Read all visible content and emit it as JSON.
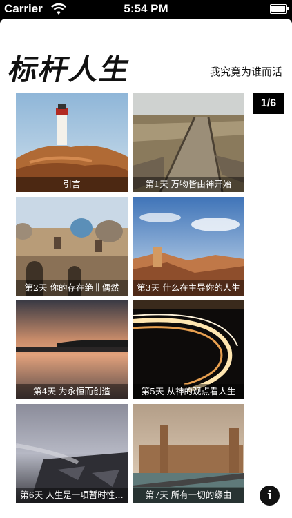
{
  "status_bar": {
    "carrier": "Carrier",
    "time": "5:54 PM"
  },
  "header": {
    "title": "标杆人生",
    "subtitle": "我究竟为谁而活"
  },
  "page_indicator": "1/6",
  "tiles": [
    {
      "caption": "引言",
      "icon": "lighthouse-photo"
    },
    {
      "caption": "第1天 万物皆由神开始",
      "icon": "boardwalk-photo"
    },
    {
      "caption": "第2天 你的存在绝非偶然",
      "icon": "church-photo"
    },
    {
      "caption": "第3天 什么在主导你的人生",
      "icon": "canyon-photo"
    },
    {
      "caption": "第4天  为永恒而创造",
      "icon": "sunset-lake-photo"
    },
    {
      "caption": "第5天 从神的观点看人生",
      "icon": "light-trails-photo"
    },
    {
      "caption": "第6天 人生是一项暂时性…",
      "icon": "rocky-coast-photo"
    },
    {
      "caption": "第7天 所有一切的缘由",
      "icon": "parliament-photo"
    }
  ],
  "info_button": "i"
}
